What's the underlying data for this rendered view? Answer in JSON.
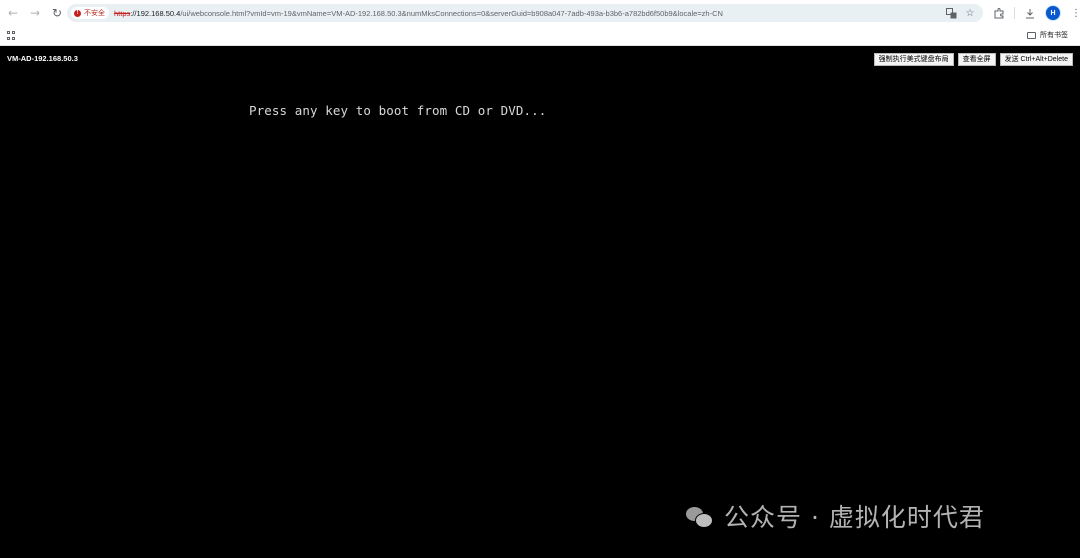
{
  "browser": {
    "nav": {
      "back": "←",
      "forward": "→",
      "reload": "↻"
    },
    "security_chip": "不安全",
    "url": {
      "scheme": "https",
      "host": "://192.168.50.4",
      "path": "/ui/webconsole.html?vmId=vm-19&vmName=VM-AD-192.168.50.3&numMksConnections=0&serverGuid=b908a047-7adb-493a-b3b6-a782bd6f50b9&locale=zh-CN"
    },
    "omnibox_icons": [
      "translate-icon",
      "star-icon"
    ],
    "avatar_letter": "H",
    "bookmarks": {
      "all_bookmarks": "所有书签"
    }
  },
  "console": {
    "vm_title": "VM-AD-192.168.50.3",
    "buttons": {
      "force_us_layout": "强制执行美式键盘布局",
      "fullscreen": "查看全屏",
      "send_cad": "发送 Ctrl+Alt+Delete"
    },
    "screen_text": "Press any key to boot from CD or DVD..."
  },
  "watermark": {
    "text": "公众号 · 虚拟化时代君"
  },
  "colors": {
    "console_bg": "#000000",
    "omnibox_bg": "#e8f0f4",
    "avatar_bg": "#0b57d0"
  }
}
